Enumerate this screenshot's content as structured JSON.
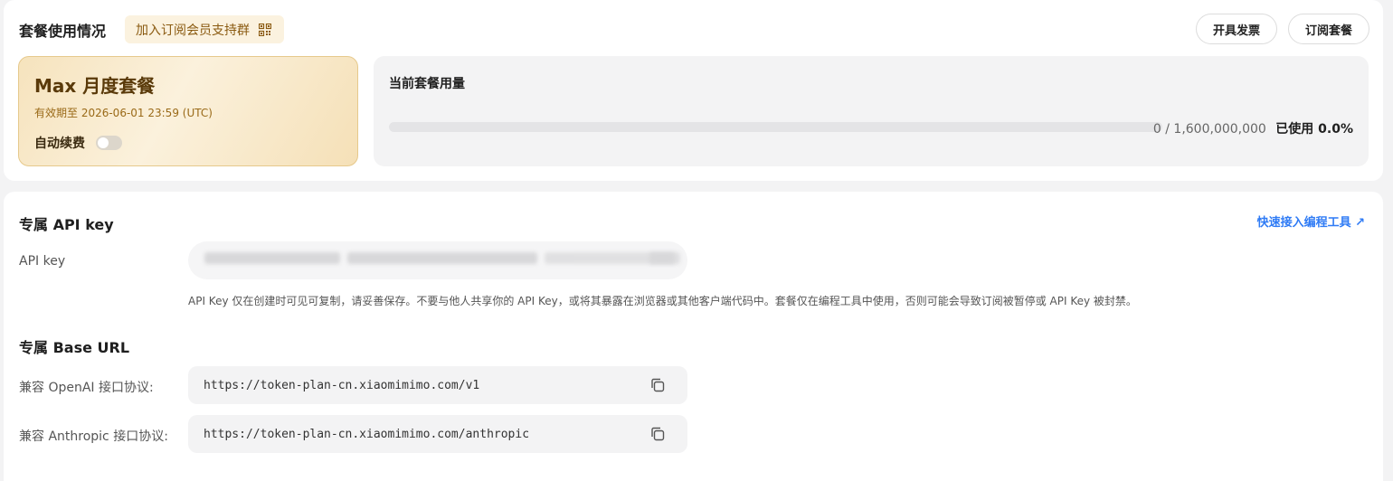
{
  "plan_section": {
    "title": "套餐使用情况",
    "group_badge_label": "加入订阅会员支持群",
    "group_badge_icon": "qr-code-icon",
    "invoice_button": "开具发票",
    "subscribe_button": "订阅套餐",
    "plan": {
      "name": "Max 月度套餐",
      "expiry": "有效期至 2026-06-01 23:59 (UTC)",
      "auto_renew_label": "自动续费",
      "auto_renew_on": false
    },
    "usage": {
      "title": "当前套餐用量",
      "count_text": "0 / 1,600,000,000",
      "percent_text": "已使用 0.0%",
      "fraction": 0.0
    }
  },
  "api_section": {
    "title": "专属 API key",
    "quick_link": "快速接入编程工具 ↗",
    "key_label": "API key",
    "key_value": "",
    "hint": "API Key 仅在创建时可见可复制，请妥善保存。不要与他人共享你的 API Key，或将其暴露在浏览器或其他客户端代码中。套餐仅在编程工具中使用，否则可能会导致订阅被暂停或 API Key 被封禁。"
  },
  "base_url_section": {
    "title": "专属 Base URL",
    "openai_label": "兼容 OpenAI 接口协议:",
    "openai_url": "https://token-plan-cn.xiaomimimo.com/v1",
    "anthropic_label": "兼容 Anthropic 接口协议:",
    "anthropic_url": "https://token-plan-cn.xiaomimimo.com/anthropic",
    "copy_icon": "copy-icon"
  },
  "colors": {
    "accent_link": "#2f7bf5",
    "plan_gold": "#e6c98c",
    "plan_text": "#5a3a0a"
  }
}
